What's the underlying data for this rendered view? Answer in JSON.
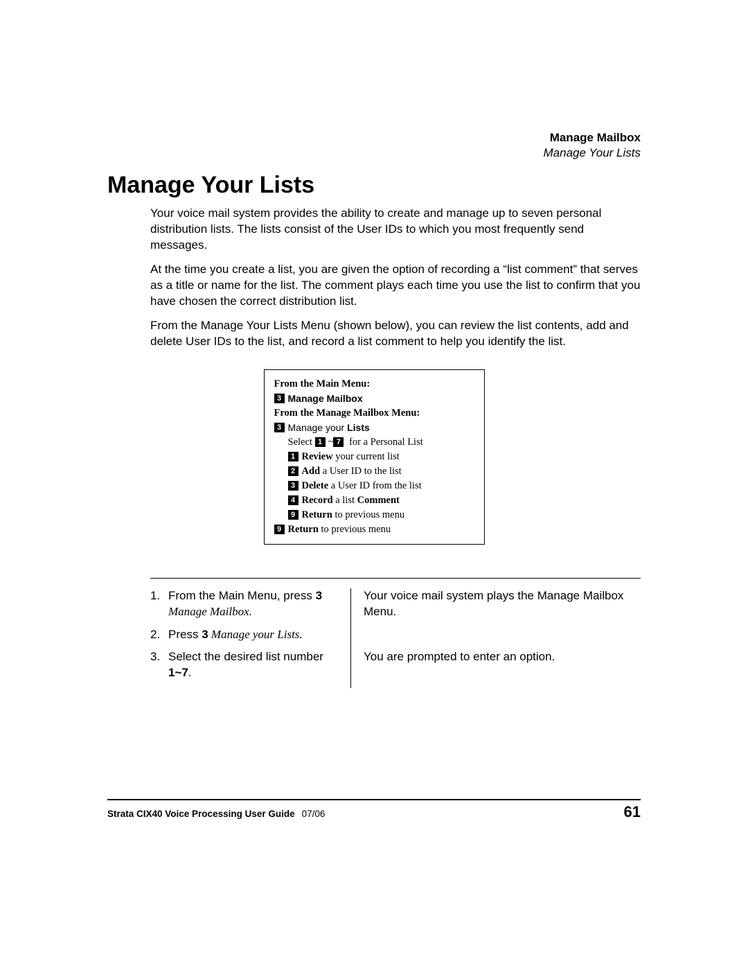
{
  "header": {
    "section": "Manage Mailbox",
    "subsection": "Manage Your Lists"
  },
  "title": "Manage Your Lists",
  "paragraphs": {
    "p1": "Your voice mail system provides the ability to create and manage up to seven personal distribution lists. The lists consist of the User IDs to which you most frequently send messages.",
    "p2": "At the time you create a list, you are given the option of recording a “list comment” that serves as a title or name for the list. The comment plays each time you use the list to confirm that you have chosen the correct distribution list.",
    "p3": "From the Manage Your Lists Menu (shown below), you can review the list contents, add and delete User IDs to the list, and record a list comment to help you identify the list."
  },
  "menu": {
    "line1": "From the Main Menu:",
    "item1_key": "3",
    "item1_text": "Manage Mailbox",
    "line2": "From the Manage Mailbox Menu:",
    "item2_key": "3",
    "item2_pre": "Manage your ",
    "item2_bold": "Lists",
    "select_pre": "Select ",
    "select_k1": "1",
    "select_mid": "~",
    "select_k2": "7",
    "select_post": " for a Personal List",
    "sub1_key": "1",
    "sub1_b": "Review",
    "sub1_t": " your current list",
    "sub2_key": "2",
    "sub2_b": "Add",
    "sub2_t": " a User ID to the list",
    "sub3_key": "3",
    "sub3_b": "Delete",
    "sub3_t": " a User ID from the list",
    "sub4_key": "4",
    "sub4_b1": "Record",
    "sub4_t1": " a list ",
    "sub4_b2": "Comment",
    "sub5_key": "9",
    "sub5_b": "Return",
    "sub5_t": " to previous menu",
    "sub6_key": "9",
    "sub6_b": "Return",
    "sub6_t": " to previous menu"
  },
  "steps": {
    "s1_num": "1.",
    "s1_left_a": "From the Main Menu, press ",
    "s1_left_key": "3",
    "s1_left_it": " Manage Mailbox.",
    "s1_right": "Your voice mail system plays the Manage Mailbox Menu.",
    "s2_num": "2.",
    "s2_left_a": "Press ",
    "s2_left_key": "3",
    "s2_left_it": " Manage your Lists.",
    "s3_num": "3.",
    "s3_left_a": "Select the desired list number ",
    "s3_left_key": "1~7",
    "s3_left_b": ".",
    "s3_right": "You are prompted to enter an option."
  },
  "footer": {
    "guide": "Strata CIX40 Voice Processing User Guide",
    "date": "07/06",
    "page": "61"
  }
}
